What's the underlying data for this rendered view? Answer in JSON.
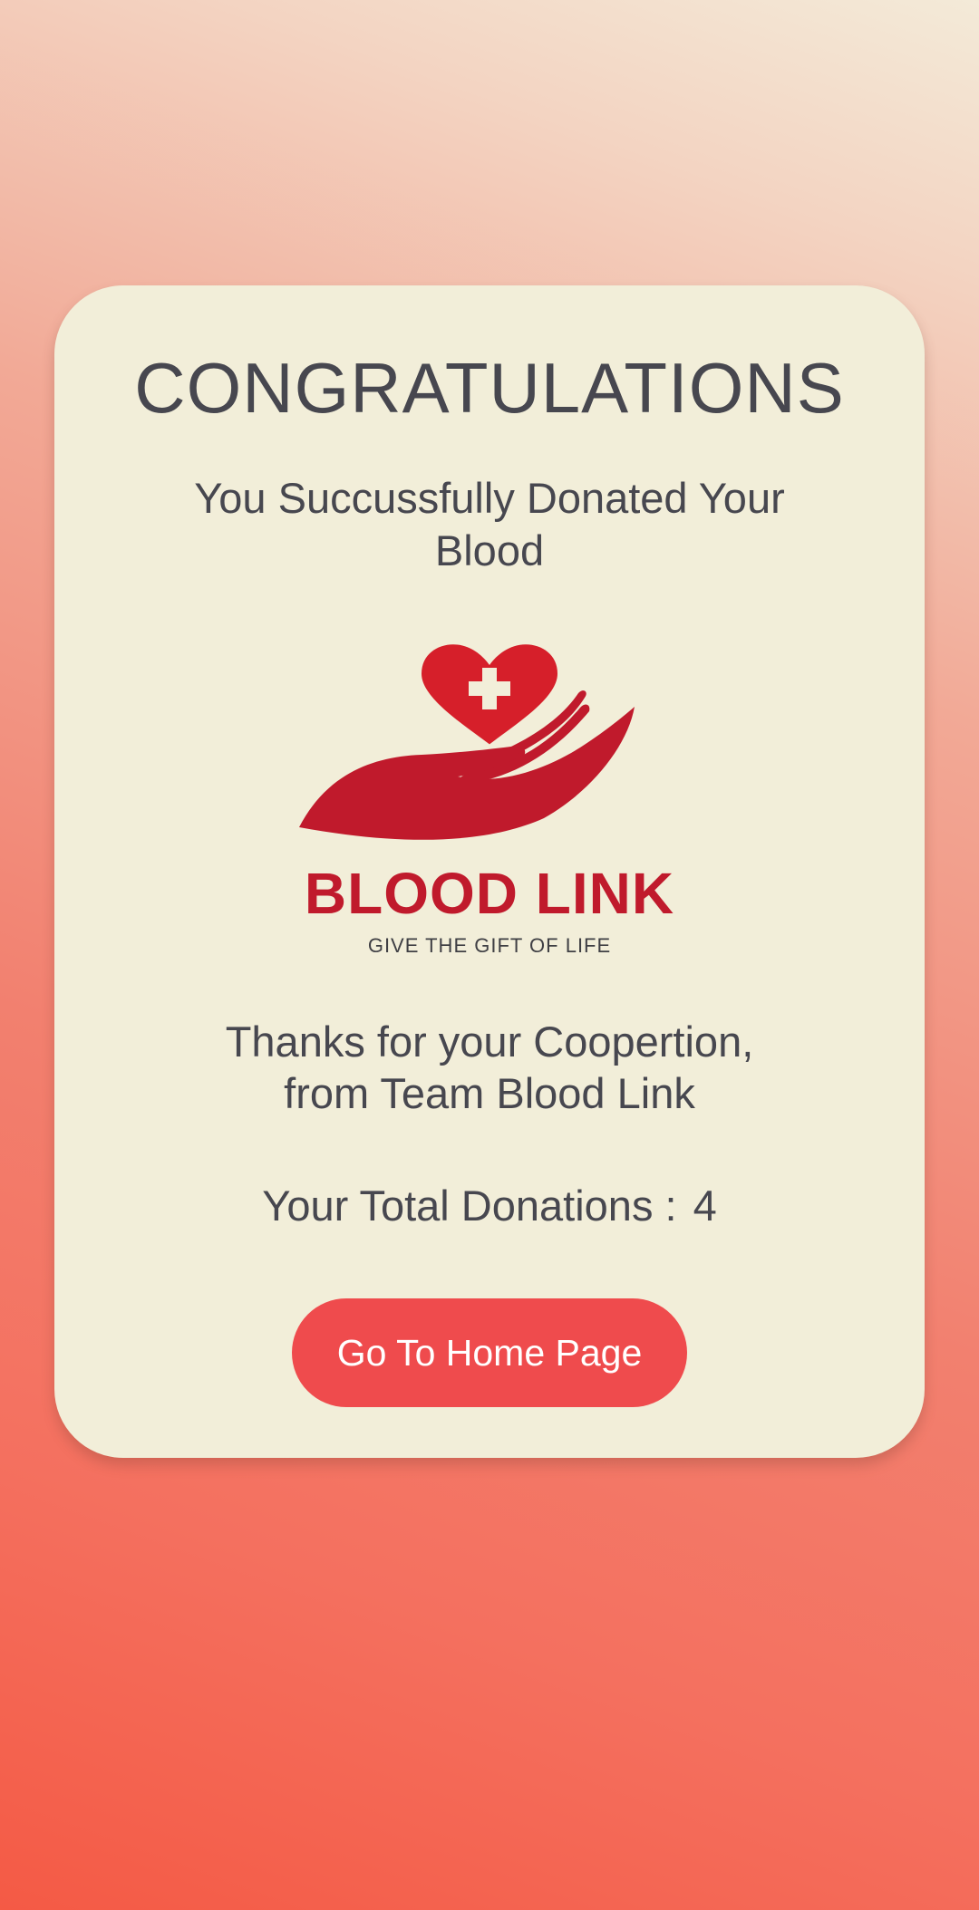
{
  "card": {
    "title": "CONGRATULATIONS",
    "subtitle": "You Succussfully Donated Your Blood",
    "logo": {
      "name": "BLOOD LINK",
      "tagline": "GIVE THE GIFT OF LIFE",
      "icon": "heart-cross-hand-icon",
      "color": "#c01a2c"
    },
    "thanks_line1": "Thanks for your Coopertion,",
    "thanks_line2": "from Team Blood Link",
    "total_label": "Your Total Donations :",
    "total_value": "4",
    "home_button": "Go To Home Page"
  },
  "colors": {
    "card_bg": "#f2eed9",
    "text": "#47474f",
    "button": "#ef4b4d",
    "brand_red": "#c01a2c"
  }
}
